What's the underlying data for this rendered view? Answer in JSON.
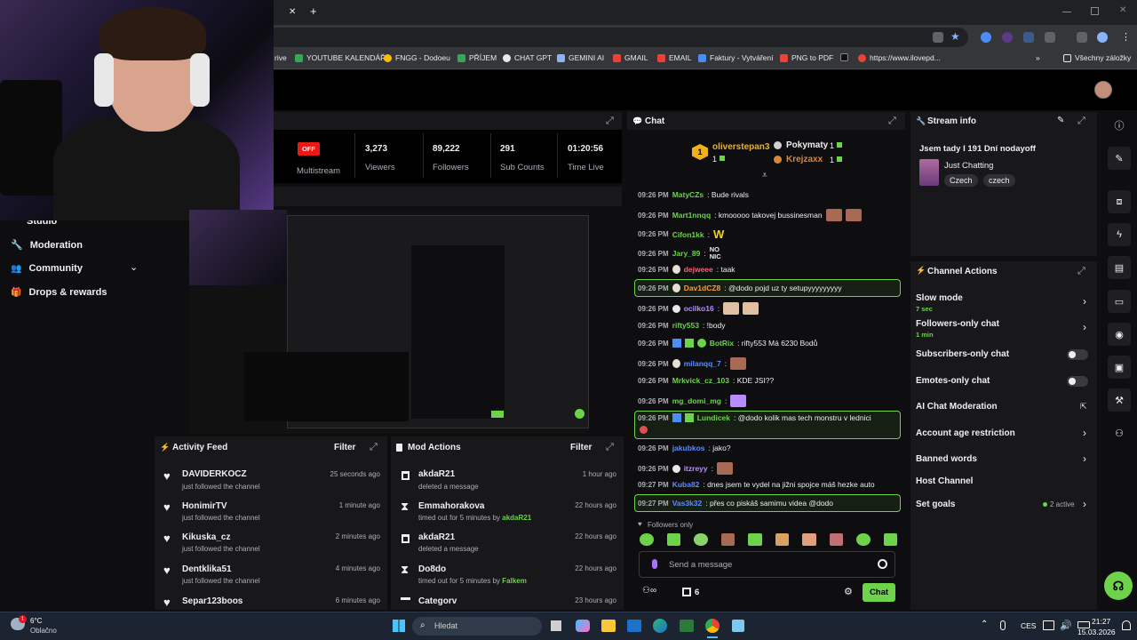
{
  "browser": {
    "close_tab": "✕",
    "new_tab": "+",
    "bookmarks": [
      "rive",
      "YOUTUBE KALENDÁŘ",
      "FNGG - Dodoeu",
      "PŘÍJEM",
      "CHAT GPT",
      "GEMINI AI",
      "GMAIL",
      "EMAIL",
      "Faktury - Vytváření",
      "PNG to PDF",
      "S",
      "https://www.ilovepd...",
      "»",
      "Všechny záložky"
    ]
  },
  "nav": {
    "items": [
      "Studio",
      "Moderation",
      "Community",
      "Drops & rewards"
    ]
  },
  "stats": {
    "off_badge": "OFF",
    "multistream": "Multistream",
    "viewers": "3,273",
    "viewers_lbl": "Viewers",
    "followers": "89,222",
    "followers_lbl": "Followers",
    "subs": "291",
    "subs_lbl": "Sub Counts",
    "time": "01:20:56",
    "time_lbl": "Time Live"
  },
  "activity": {
    "title": "Activity Feed",
    "filter": "Filter",
    "rows": [
      {
        "name": "DAVIDERKOCZ",
        "sub": "just followed the channel",
        "time": "25 seconds ago"
      },
      {
        "name": "HonimirTV",
        "sub": "just followed the channel",
        "time": "1 minute ago"
      },
      {
        "name": "Kikuska_cz",
        "sub": "just followed the channel",
        "time": "2 minutes ago"
      },
      {
        "name": "Dentklika51",
        "sub": "just followed the channel",
        "time": "4 minutes ago"
      },
      {
        "name": "Separ123boos",
        "sub": "",
        "time": "6 minutes ago"
      }
    ]
  },
  "mod": {
    "title": "Mod Actions",
    "filter": "Filter",
    "rows": [
      {
        "name": "akdaR21",
        "sub": "deleted a message",
        "by": "",
        "time": "1 hour ago"
      },
      {
        "name": "Emmahorakova",
        "sub": "timed out for 5 minutes by ",
        "by": "akdaR21",
        "time": "22 hours ago"
      },
      {
        "name": "akdaR21",
        "sub": "deleted a message",
        "by": "",
        "time": "22 hours ago"
      },
      {
        "name": "Do8do",
        "sub": "timed out for 5 minutes by ",
        "by": "Falkem",
        "time": "22 hours ago"
      },
      {
        "name": "Categorv",
        "sub": "",
        "by": "",
        "time": "23 hours ago"
      }
    ]
  },
  "chat": {
    "title": "Chat",
    "top": {
      "first": "oliverstepan3",
      "first_count": "1",
      "rank": "1",
      "second": "Pokymaty",
      "second_count": "1",
      "third": "Krejzaxx",
      "third_count": "1"
    },
    "messages": [
      {
        "time": "09:26 PM",
        "user": "MatyCZs",
        "color": "#6cd34a",
        "text": ": Bude rivals"
      },
      {
        "time": "09:26 PM",
        "user": "Mart1nnqq",
        "color": "#6cd34a",
        "text": ": kmooooo takovej bussinesman"
      },
      {
        "time": "09:26 PM",
        "user": "Cifon1kk",
        "color": "#6cd34a",
        "text": ":"
      },
      {
        "time": "09:26 PM",
        "user": "Jary_89",
        "color": "#6cd34a",
        "text": ":",
        "badge": "NO NIC"
      },
      {
        "time": "09:26 PM",
        "user": "dejweee",
        "color": "#ff5f72",
        "text": ": taak"
      },
      {
        "time": "09:26 PM",
        "user": "Dav1dCZ8",
        "color": "#ff9a3c",
        "text": ": @dodo pojd uz ty setupyyyyyyyyy"
      },
      {
        "time": "09:26 PM",
        "user": "ocilko16",
        "color": "#b88cff",
        "text": ":"
      },
      {
        "time": "09:26 PM",
        "user": "rifty553",
        "color": "#6cd34a",
        "text": ": !body"
      },
      {
        "time": "09:26 PM",
        "user": "BotRix",
        "color": "#6cd34a",
        "text": ": rifty553 Má 6230 Bodů"
      },
      {
        "time": "09:26 PM",
        "user": "milanqq_7",
        "color": "#5c8bff",
        "text": ":"
      },
      {
        "time": "09:26 PM",
        "user": "Mrkvick_cz_103",
        "color": "#6cd34a",
        "text": ": KDE JSI??"
      },
      {
        "time": "09:26 PM",
        "user": "mg_domi_mg",
        "color": "#6cd34a",
        "text": ":"
      },
      {
        "time": "09:26 PM",
        "user": "Lundicek",
        "color": "#6cd34a",
        "text": ": @dodo kolik mas tech monstru v lednici"
      },
      {
        "time": "09:26 PM",
        "user": "jakubkos",
        "color": "#5c8bff",
        "text": ": jako?"
      },
      {
        "time": "09:26 PM",
        "user": "itzreyy",
        "color": "#b88cff",
        "text": ":"
      },
      {
        "time": "09:27 PM",
        "user": "Kuba82",
        "color": "#5c8bff",
        "text": ": dnes jsem te vydel na jižni spojce máš hezke auto"
      },
      {
        "time": "09:27 PM",
        "user": "Vas3k32",
        "color": "#5c8bff",
        "text": ": přes co piskáš samimu videa @dodo"
      }
    ],
    "followers_only": "Followers only",
    "placeholder": "Send a message",
    "bottom_count": "6",
    "send": "Chat"
  },
  "stream_info": {
    "title": "Stream info",
    "stream_title": "Jsem tady I 191 Dní nodayoff",
    "category": "Just Chatting",
    "tags": [
      "Czech",
      "czech"
    ]
  },
  "channel_actions": {
    "title": "Channel Actions",
    "slow_mode": "Slow mode",
    "slow_sub": "7 sec",
    "followers_only": "Followers-only chat",
    "followers_sub": "1 min",
    "subs_only": "Subscribers-only chat",
    "emotes_only": "Emotes-only chat",
    "ai_mod": "AI Chat Moderation",
    "age": "Account age restriction",
    "banned": "Banned words",
    "host": "Host Channel",
    "goals": "Set goals",
    "goals_active": "2 active"
  },
  "taskbar": {
    "weather_temp": "6°C",
    "weather_desc": "Oblačno",
    "weather_badge": "1",
    "search": "Hledat",
    "lang": "CES",
    "time": "21:27",
    "date": "15.03.2026"
  },
  "colors": {
    "accent": "#6cd34a",
    "panel": "#18181b",
    "bg": "#0e0e10"
  }
}
